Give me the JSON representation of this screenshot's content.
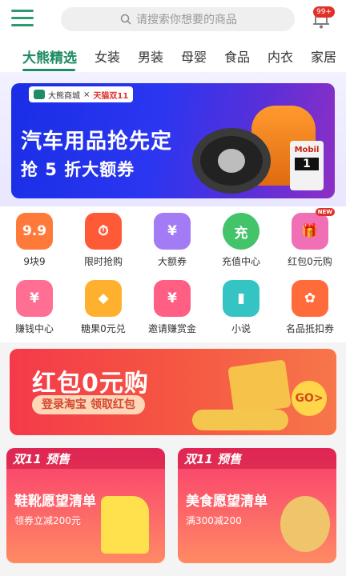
{
  "header": {
    "search_placeholder": "请搜索你想要的商品",
    "badge": "99+"
  },
  "tabs": [
    "大熊精选",
    "女装",
    "男装",
    "母婴",
    "食品",
    "内衣",
    "家居"
  ],
  "banner": {
    "chip_brand": "大熊商城",
    "chip_x": "×",
    "chip_partner": "天猫双11",
    "title": "汽车用品抢先定",
    "subtitle": "抢 5 折大额券",
    "oil_brand": "Mobil",
    "oil_number": "1"
  },
  "grid": [
    {
      "label": "9块9",
      "glyph": "9.9",
      "color": "#ff7a3a"
    },
    {
      "label": "限时抢购",
      "glyph": "⏱",
      "color": "#ff5a38"
    },
    {
      "label": "大额券",
      "glyph": "¥",
      "color": "#a37bf5"
    },
    {
      "label": "充值中心",
      "glyph": "充",
      "color": "#43c36a"
    },
    {
      "label": "红包0元购",
      "glyph": "🎁",
      "color": "#f06fb5",
      "tag": "NEW"
    },
    {
      "label": "赚钱中心",
      "glyph": "¥",
      "color": "#ff6e93"
    },
    {
      "label": "糖果0元兑",
      "glyph": "◆",
      "color": "#ffb02e"
    },
    {
      "label": "邀请赚赏金",
      "glyph": "¥",
      "color": "#ff5f82"
    },
    {
      "label": "小说",
      "glyph": "▮",
      "color": "#35c4c4"
    },
    {
      "label": "名品抵扣券",
      "glyph": "✿",
      "color": "#ff6b3a"
    }
  ],
  "redpack": {
    "title": "红包0元购",
    "button": "登录淘宝 领取红包",
    "go": "GO>"
  },
  "cards": [
    {
      "tag": "双11 预售",
      "title": "鞋靴愿望清单",
      "sub": "领券立减200元"
    },
    {
      "tag": "双11 预售",
      "title": "美食愿望清单",
      "sub": "满300减200"
    }
  ]
}
